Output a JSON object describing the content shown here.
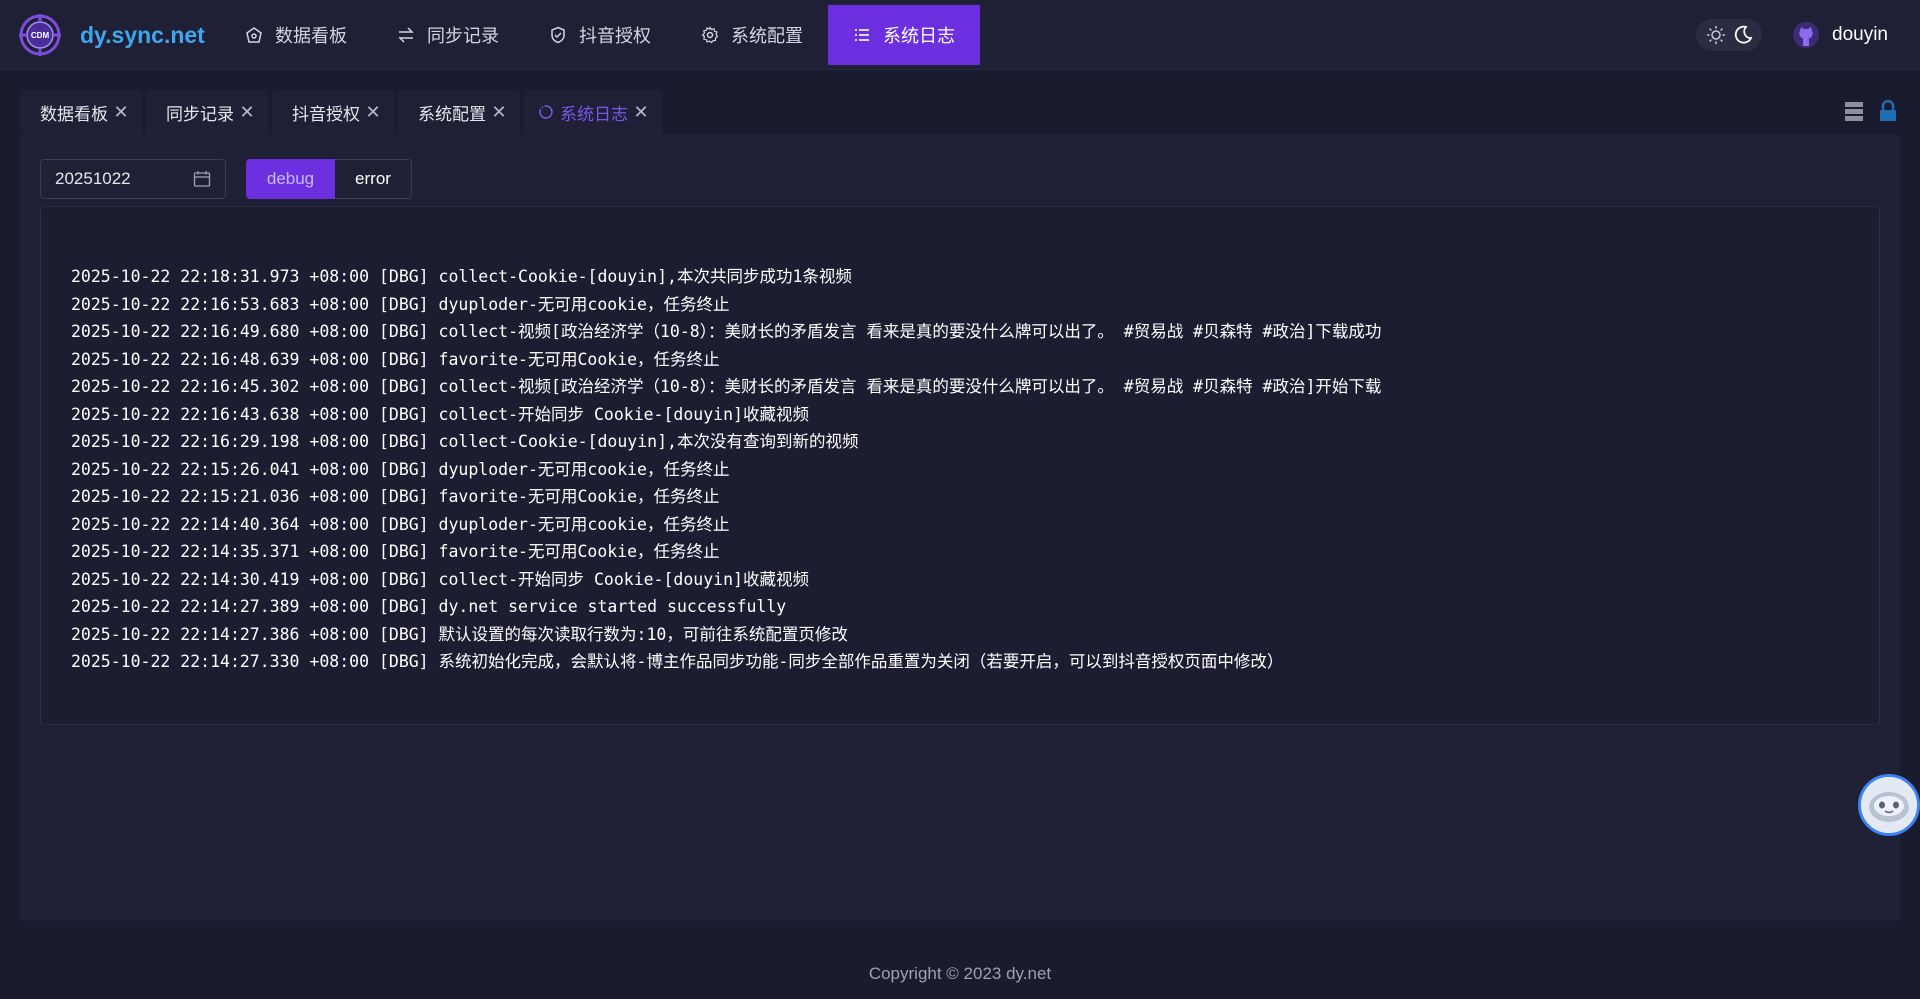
{
  "header": {
    "brand": "dy.sync.net",
    "logo_text": "CDM",
    "nav": [
      {
        "label": "数据看板",
        "icon": "dashboard-icon",
        "active": false
      },
      {
        "label": "同步记录",
        "icon": "sync-arrows-icon",
        "active": false
      },
      {
        "label": "抖音授权",
        "icon": "shield-icon",
        "active": false
      },
      {
        "label": "系统配置",
        "icon": "gear-icon",
        "active": false
      },
      {
        "label": "系统日志",
        "icon": "list-icon",
        "active": true
      }
    ],
    "theme_icons": [
      "sun-icon",
      "moon-icon"
    ],
    "user_name": "douyin",
    "user_icon": "github-icon"
  },
  "tabs": [
    {
      "label": "数据看板",
      "active": false
    },
    {
      "label": "同步记录",
      "active": false
    },
    {
      "label": "抖音授权",
      "active": false
    },
    {
      "label": "系统配置",
      "active": false
    },
    {
      "label": "系统日志",
      "active": true
    }
  ],
  "tab_close_glyph": "✕",
  "tab_tools": [
    "list-view-icon",
    "lock-icon"
  ],
  "filters": {
    "date_value": "20251022",
    "level_options": [
      "debug",
      "error"
    ],
    "selected_level": "debug"
  },
  "logs": [
    "2025-10-22 22:18:31.973 +08:00 [DBG] collect-Cookie-[douyin],本次共同步成功1条视频",
    "2025-10-22 22:16:53.683 +08:00 [DBG] dyuploder-无可用cookie，任务终止",
    "2025-10-22 22:16:49.680 +08:00 [DBG] collect-视频[政治经济学（10-8）：美财长的矛盾发言 看来是真的要没什么牌可以出了。 #贸易战 #贝森特 #政治]下载成功",
    "2025-10-22 22:16:48.639 +08:00 [DBG] favorite-无可用Cookie，任务终止",
    "2025-10-22 22:16:45.302 +08:00 [DBG] collect-视频[政治经济学（10-8）：美财长的矛盾发言 看来是真的要没什么牌可以出了。 #贸易战 #贝森特 #政治]开始下载",
    "2025-10-22 22:16:43.638 +08:00 [DBG] collect-开始同步 Cookie-[douyin]收藏视频",
    "2025-10-22 22:16:29.198 +08:00 [DBG] collect-Cookie-[douyin],本次没有查询到新的视频",
    "2025-10-22 22:15:26.041 +08:00 [DBG] dyuploder-无可用cookie，任务终止",
    "2025-10-22 22:15:21.036 +08:00 [DBG] favorite-无可用Cookie，任务终止",
    "2025-10-22 22:14:40.364 +08:00 [DBG] dyuploder-无可用cookie，任务终止",
    "2025-10-22 22:14:35.371 +08:00 [DBG] favorite-无可用Cookie，任务终止",
    "2025-10-22 22:14:30.419 +08:00 [DBG] collect-开始同步 Cookie-[douyin]收藏视频",
    "2025-10-22 22:14:27.389 +08:00 [DBG] dy.net service started successfully",
    "2025-10-22 22:14:27.386 +08:00 [DBG] 默认设置的每次读取行数为:10，可前往系统配置页修改",
    "2025-10-22 22:14:27.330 +08:00 [DBG] 系统初始化完成，会默认将-博主作品同步功能-同步全部作品重置为关闭（若要开启，可以到抖音授权页面中修改）"
  ],
  "footer": "Copyright © 2023 dy.net",
  "colors": {
    "accent": "#6b2fe0",
    "brand": "#3ea7f0",
    "background": "#1a1b2e",
    "panel": "#1f2035"
  }
}
